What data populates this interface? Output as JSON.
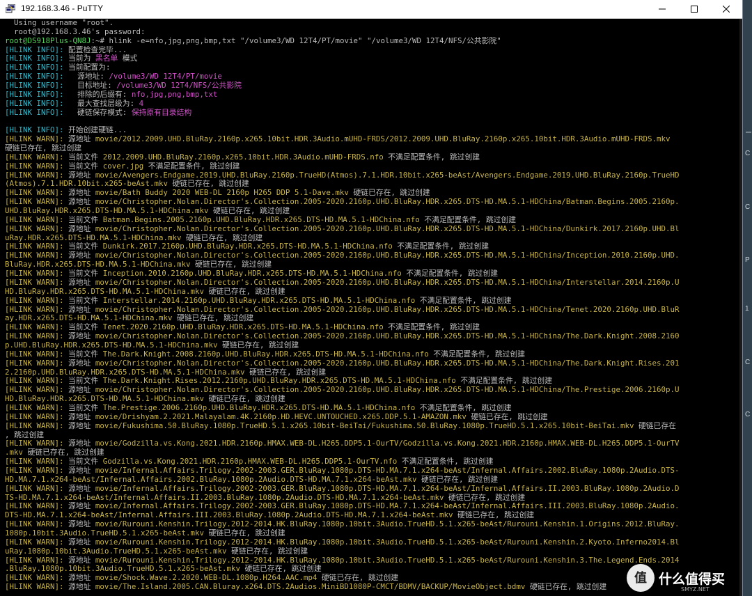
{
  "window": {
    "title": "192.168.3.46 - PuTTY"
  },
  "watermark": {
    "text": "什么值得买",
    "sub": "SMYZ.NET"
  },
  "side_glyphs": [
    "ー",
    "C",
    "C",
    "P",
    "1",
    "C",
    "C"
  ],
  "colors": {
    "info": "#3ab7c8",
    "warn": "#c8b44a",
    "highlight": "#d052c8",
    "prompt": "#55d45c",
    "text": "#bbbbbb"
  },
  "terminal": {
    "lines": [
      [
        {
          "t": "  Using username \"root\".",
          "c": "white"
        }
      ],
      [
        {
          "t": "  root@192.168.3.46's password:",
          "c": "white"
        }
      ],
      [
        {
          "t": "root@DS918Plus-QN8J",
          "c": "green"
        },
        {
          "t": ":~# hlink -e=nfo,jpg,png,bmp,txt \"/volume3/WD 12T4/PT/movie\" \"/volume3/WD 12T4/NFS/公共影院\"",
          "c": "white"
        }
      ],
      [
        {
          "t": "[HLINK INFO]: ",
          "c": "cyan"
        },
        {
          "t": "配置检查完毕...",
          "c": "white"
        }
      ],
      [
        {
          "t": "[HLINK INFO]: ",
          "c": "cyan"
        },
        {
          "t": "当前为 ",
          "c": "white"
        },
        {
          "t": "黑名单",
          "c": "magenta"
        },
        {
          "t": " 模式",
          "c": "white"
        }
      ],
      [
        {
          "t": "[HLINK INFO]: ",
          "c": "cyan"
        },
        {
          "t": "当前配置为:",
          "c": "white"
        }
      ],
      [
        {
          "t": "[HLINK INFO]: ",
          "c": "cyan"
        },
        {
          "t": "  源地址: ",
          "c": "white"
        },
        {
          "t": "/volume3/WD 12T4/PT/movie",
          "c": "magenta"
        }
      ],
      [
        {
          "t": "[HLINK INFO]: ",
          "c": "cyan"
        },
        {
          "t": "  目标地址: ",
          "c": "white"
        },
        {
          "t": "/volume3/WD 12T4/NFS/公共影院",
          "c": "magenta"
        }
      ],
      [
        {
          "t": "[HLINK INFO]: ",
          "c": "cyan"
        },
        {
          "t": "  排除的后缀有: ",
          "c": "white"
        },
        {
          "t": "nfo,jpg,png,bmp,txt",
          "c": "magenta"
        }
      ],
      [
        {
          "t": "[HLINK INFO]: ",
          "c": "cyan"
        },
        {
          "t": "  最大查找层级为: ",
          "c": "white"
        },
        {
          "t": "4",
          "c": "magenta"
        }
      ],
      [
        {
          "t": "[HLINK INFO]: ",
          "c": "cyan"
        },
        {
          "t": "  硬链保存模式: ",
          "c": "white"
        },
        {
          "t": "保持原有目录结构",
          "c": "magenta"
        }
      ],
      [
        {
          "t": "",
          "c": "white"
        }
      ],
      [
        {
          "t": "[HLINK INFO]: ",
          "c": "cyan"
        },
        {
          "t": "开始创建硬链...",
          "c": "white"
        }
      ],
      [
        {
          "t": "[HLINK WARN]: ",
          "c": "yellow"
        },
        {
          "t": "源地址 ",
          "c": "white"
        },
        {
          "t": "movie/2012.2009.UHD.BluRay.2160p.x265.10bit.HDR.3Audio.mUHD-FRDS/2012.2009.UHD.BluRay.2160p.x265.10bit.HDR.3Audio.mUHD-FRDS.mkv",
          "c": "yellow"
        }
      ],
      [
        {
          "t": "硬链已存在, 跳过创建",
          "c": "white"
        }
      ],
      [
        {
          "t": "[HLINK WARN]: ",
          "c": "yellow"
        },
        {
          "t": "当前文件 ",
          "c": "white"
        },
        {
          "t": "2012.2009.UHD.BluRay.2160p.x265.10bit.HDR.3Audio.mUHD-FRDS.nfo",
          "c": "yellow"
        },
        {
          "t": " 不满足配置条件, 跳过创建",
          "c": "white"
        }
      ],
      [
        {
          "t": "[HLINK WARN]: ",
          "c": "yellow"
        },
        {
          "t": "当前文件 ",
          "c": "white"
        },
        {
          "t": "cover.jpg",
          "c": "yellow"
        },
        {
          "t": " 不满足配置条件, 跳过创建",
          "c": "white"
        }
      ],
      [
        {
          "t": "[HLINK WARN]: ",
          "c": "yellow"
        },
        {
          "t": "源地址 ",
          "c": "white"
        },
        {
          "t": "movie/Avengers.Endgame.2019.UHD.BluRay.2160p.TrueHD(Atmos).7.1.HDR.10bit.x265-beAst/Avengers.Endgame.2019.UHD.BluRay.2160p.TrueHD",
          "c": "yellow"
        }
      ],
      [
        {
          "t": "(Atmos).7.1.HDR.10bit.x265-beAst.mkv",
          "c": "yellow"
        },
        {
          "t": " 硬链已存在, 跳过创建",
          "c": "white"
        }
      ],
      [
        {
          "t": "[HLINK WARN]: ",
          "c": "yellow"
        },
        {
          "t": "源地址 ",
          "c": "white"
        },
        {
          "t": "movie/Bath Buddy 2020 WEB-DL 2160p H265 DDP 5.1-Dave.mkv",
          "c": "yellow"
        },
        {
          "t": " 硬链已存在, 跳过创建",
          "c": "white"
        }
      ],
      [
        {
          "t": "[HLINK WARN]: ",
          "c": "yellow"
        },
        {
          "t": "源地址 ",
          "c": "white"
        },
        {
          "t": "movie/Christopher.Nolan.Director's.Collection.2005-2020.2160p.UHD.BluRay.HDR.x265.DTS-HD.MA.5.1-HDChina/Batman.Begins.2005.2160p.",
          "c": "yellow"
        }
      ],
      [
        {
          "t": "UHD.BluRay.HDR.x265.DTS-HD.MA.5.1-HDChina.mkv",
          "c": "yellow"
        },
        {
          "t": " 硬链已存在, 跳过创建",
          "c": "white"
        }
      ],
      [
        {
          "t": "[HLINK WARN]: ",
          "c": "yellow"
        },
        {
          "t": "当前文件 ",
          "c": "white"
        },
        {
          "t": "Batman.Begins.2005.2160p.UHD.BluRay.HDR.x265.DTS-HD.MA.5.1-HDChina.nfo",
          "c": "yellow"
        },
        {
          "t": " 不满足配置条件, 跳过创建",
          "c": "white"
        }
      ],
      [
        {
          "t": "[HLINK WARN]: ",
          "c": "yellow"
        },
        {
          "t": "源地址 ",
          "c": "white"
        },
        {
          "t": "movie/Christopher.Nolan.Director's.Collection.2005-2020.2160p.UHD.BluRay.HDR.x265.DTS-HD.MA.5.1-HDChina/Dunkirk.2017.2160p.UHD.Bl",
          "c": "yellow"
        }
      ],
      [
        {
          "t": "uRay.HDR.x265.DTS-HD.MA.5.1-HDChina.mkv",
          "c": "yellow"
        },
        {
          "t": " 硬链已存在, 跳过创建",
          "c": "white"
        }
      ],
      [
        {
          "t": "[HLINK WARN]: ",
          "c": "yellow"
        },
        {
          "t": "当前文件 ",
          "c": "white"
        },
        {
          "t": "Dunkirk.2017.2160p.UHD.BluRay.HDR.x265.DTS-HD.MA.5.1-HDChina.nfo",
          "c": "yellow"
        },
        {
          "t": " 不满足配置条件, 跳过创建",
          "c": "white"
        }
      ],
      [
        {
          "t": "[HLINK WARN]: ",
          "c": "yellow"
        },
        {
          "t": "源地址 ",
          "c": "white"
        },
        {
          "t": "movie/Christopher.Nolan.Director's.Collection.2005-2020.2160p.UHD.BluRay.HDR.x265.DTS-HD.MA.5.1-HDChina/Inception.2010.2160p.UHD.",
          "c": "yellow"
        }
      ],
      [
        {
          "t": "BluRay.HDR.x265.DTS-HD.MA.5.1-HDChina.mkv",
          "c": "yellow"
        },
        {
          "t": " 硬链已存在, 跳过创建",
          "c": "white"
        }
      ],
      [
        {
          "t": "[HLINK WARN]: ",
          "c": "yellow"
        },
        {
          "t": "当前文件 ",
          "c": "white"
        },
        {
          "t": "Inception.2010.2160p.UHD.BluRay.HDR.x265.DTS-HD.MA.5.1-HDChina.nfo",
          "c": "yellow"
        },
        {
          "t": " 不满足配置条件, 跳过创建",
          "c": "white"
        }
      ],
      [
        {
          "t": "[HLINK WARN]: ",
          "c": "yellow"
        },
        {
          "t": "源地址 ",
          "c": "white"
        },
        {
          "t": "movie/Christopher.Nolan.Director's.Collection.2005-2020.2160p.UHD.BluRay.HDR.x265.DTS-HD.MA.5.1-HDChina/Interstellar.2014.2160p.U",
          "c": "yellow"
        }
      ],
      [
        {
          "t": "HD.BluRay.HDR.x265.DTS-HD.MA.5.1-HDChina.mkv",
          "c": "yellow"
        },
        {
          "t": " 硬链已存在, 跳过创建",
          "c": "white"
        }
      ],
      [
        {
          "t": "[HLINK WARN]: ",
          "c": "yellow"
        },
        {
          "t": "当前文件 ",
          "c": "white"
        },
        {
          "t": "Interstellar.2014.2160p.UHD.BluRay.HDR.x265.DTS-HD.MA.5.1-HDChina.nfo",
          "c": "yellow"
        },
        {
          "t": " 不满足配置条件, 跳过创建",
          "c": "white"
        }
      ],
      [
        {
          "t": "[HLINK WARN]: ",
          "c": "yellow"
        },
        {
          "t": "源地址 ",
          "c": "white"
        },
        {
          "t": "movie/Christopher.Nolan.Director's.Collection.2005-2020.2160p.UHD.BluRay.HDR.x265.DTS-HD.MA.5.1-HDChina/Tenet.2020.2160p.UHD.BluR",
          "c": "yellow"
        }
      ],
      [
        {
          "t": "ay.HDR.x265.DTS-HD.MA.5.1-HDChina.mkv",
          "c": "yellow"
        },
        {
          "t": " 硬链已存在, 跳过创建",
          "c": "white"
        }
      ],
      [
        {
          "t": "[HLINK WARN]: ",
          "c": "yellow"
        },
        {
          "t": "当前文件 ",
          "c": "white"
        },
        {
          "t": "Tenet.2020.2160p.UHD.BluRay.HDR.x265.DTS-HD.MA.5.1-HDChina.nfo",
          "c": "yellow"
        },
        {
          "t": " 不满足配置条件, 跳过创建",
          "c": "white"
        }
      ],
      [
        {
          "t": "[HLINK WARN]: ",
          "c": "yellow"
        },
        {
          "t": "源地址 ",
          "c": "white"
        },
        {
          "t": "movie/Christopher.Nolan.Director's.Collection.2005-2020.2160p.UHD.BluRay.HDR.x265.DTS-HD.MA.5.1-HDChina/The.Dark.Knight.2008.2160",
          "c": "yellow"
        }
      ],
      [
        {
          "t": "p.UHD.BluRay.HDR.x265.DTS-HD.MA.5.1-HDChina.mkv",
          "c": "yellow"
        },
        {
          "t": " 硬链已存在, 跳过创建",
          "c": "white"
        }
      ],
      [
        {
          "t": "[HLINK WARN]: ",
          "c": "yellow"
        },
        {
          "t": "当前文件 ",
          "c": "white"
        },
        {
          "t": "The.Dark.Knight.2008.2160p.UHD.BluRay.HDR.x265.DTS-HD.MA.5.1-HDChina.nfo",
          "c": "yellow"
        },
        {
          "t": " 不满足配置条件, 跳过创建",
          "c": "white"
        }
      ],
      [
        {
          "t": "[HLINK WARN]: ",
          "c": "yellow"
        },
        {
          "t": "源地址 ",
          "c": "white"
        },
        {
          "t": "movie/Christopher.Nolan.Director's.Collection.2005-2020.2160p.UHD.BluRay.HDR.x265.DTS-HD.MA.5.1-HDChina/The.Dark.Knight.Rises.201",
          "c": "yellow"
        }
      ],
      [
        {
          "t": "2.2160p.UHD.BluRay.HDR.x265.DTS-HD.MA.5.1-HDChina.mkv",
          "c": "yellow"
        },
        {
          "t": " 硬链已存在, 跳过创建",
          "c": "white"
        }
      ],
      [
        {
          "t": "[HLINK WARN]: ",
          "c": "yellow"
        },
        {
          "t": "当前文件 ",
          "c": "white"
        },
        {
          "t": "The.Dark.Knight.Rises.2012.2160p.UHD.BluRay.HDR.x265.DTS-HD.MA.5.1-HDChina.nfo",
          "c": "yellow"
        },
        {
          "t": " 不满足配置条件, 跳过创建",
          "c": "white"
        }
      ],
      [
        {
          "t": "[HLINK WARN]: ",
          "c": "yellow"
        },
        {
          "t": "源地址 ",
          "c": "white"
        },
        {
          "t": "movie/Christopher.Nolan.Director's.Collection.2005-2020.2160p.UHD.BluRay.HDR.x265.DTS-HD.MA.5.1-HDChina/The.Prestige.2006.2160p.U",
          "c": "yellow"
        }
      ],
      [
        {
          "t": "HD.BluRay.HDR.x265.DTS-HD.MA.5.1-HDChina.mkv",
          "c": "yellow"
        },
        {
          "t": " 硬链已存在, 跳过创建",
          "c": "white"
        }
      ],
      [
        {
          "t": "[HLINK WARN]: ",
          "c": "yellow"
        },
        {
          "t": "当前文件 ",
          "c": "white"
        },
        {
          "t": "The.Prestige.2006.2160p.UHD.BluRay.HDR.x265.DTS-HD.MA.5.1-HDChina.nfo",
          "c": "yellow"
        },
        {
          "t": " 不满足配置条件, 跳过创建",
          "c": "white"
        }
      ],
      [
        {
          "t": "[HLINK WARN]: ",
          "c": "yellow"
        },
        {
          "t": "源地址 ",
          "c": "white"
        },
        {
          "t": "movie/Drishyam.2.2021.Malayalam.4K.2160p.HD.HEVC.UNTOUCHED.x265.DDP.5.1-AMAZON.mkv",
          "c": "yellow"
        },
        {
          "t": " 硬链已存在, 跳过创建",
          "c": "white"
        }
      ],
      [
        {
          "t": "[HLINK WARN]: ",
          "c": "yellow"
        },
        {
          "t": "源地址 ",
          "c": "white"
        },
        {
          "t": "movie/Fukushima.50.BluRay.1080p.TrueHD.5.1.x265.10bit-BeiTai/Fukushima.50.BluRay.1080p.TrueHD.5.1.x265.10bit-BeiTai.mkv",
          "c": "yellow"
        },
        {
          "t": " 硬链已存在",
          "c": "white"
        }
      ],
      [
        {
          "t": ", 跳过创建",
          "c": "white"
        }
      ],
      [
        {
          "t": "[HLINK WARN]: ",
          "c": "yellow"
        },
        {
          "t": "源地址 ",
          "c": "white"
        },
        {
          "t": "movie/Godzilla.vs.Kong.2021.HDR.2160p.HMAX.WEB-DL.H265.DDP5.1-OurTV/Godzilla.vs.Kong.2021.HDR.2160p.HMAX.WEB-DL.H265.DDP5.1-OurTV",
          "c": "yellow"
        }
      ],
      [
        {
          "t": ".mkv",
          "c": "yellow"
        },
        {
          "t": " 硬链已存在, 跳过创建",
          "c": "white"
        }
      ],
      [
        {
          "t": "[HLINK WARN]: ",
          "c": "yellow"
        },
        {
          "t": "当前文件 ",
          "c": "white"
        },
        {
          "t": "Godzilla.vs.Kong.2021.HDR.2160p.HMAX.WEB-DL.H265.DDP5.1-OurTV.nfo",
          "c": "yellow"
        },
        {
          "t": " 不满足配置条件, 跳过创建",
          "c": "white"
        }
      ],
      [
        {
          "t": "[HLINK WARN]: ",
          "c": "yellow"
        },
        {
          "t": "源地址 ",
          "c": "white"
        },
        {
          "t": "movie/Infernal.Affairs.Trilogy.2002-2003.GER.BluRay.1080p.DTS-HD.MA.7.1.x264-beAst/Infernal.Affairs.2002.BluRay.1080p.2Audio.DTS-",
          "c": "yellow"
        }
      ],
      [
        {
          "t": "HD.MA.7.1.x264-beAst/Infernal.Affairs.2002.BluRay.1080p.2Audio.DTS-HD.MA.7.1.x264-beAst.mkv",
          "c": "yellow"
        },
        {
          "t": " 硬链已存在, 跳过创建",
          "c": "white"
        }
      ],
      [
        {
          "t": "[HLINK WARN]: ",
          "c": "yellow"
        },
        {
          "t": "源地址 ",
          "c": "white"
        },
        {
          "t": "movie/Infernal.Affairs.Trilogy.2002-2003.GER.BluRay.1080p.DTS-HD.MA.7.1.x264-beAst/Infernal.Affairs.II.2003.BluRay.1080p.2Audio.D",
          "c": "yellow"
        }
      ],
      [
        {
          "t": "TS-HD.MA.7.1.x264-beAst/Infernal.Affairs.II.2003.BluRay.1080p.2Audio.DTS-HD.MA.7.1.x264-beAst.mkv",
          "c": "yellow"
        },
        {
          "t": " 硬链已存在, 跳过创建",
          "c": "white"
        }
      ],
      [
        {
          "t": "[HLINK WARN]: ",
          "c": "yellow"
        },
        {
          "t": "源地址 ",
          "c": "white"
        },
        {
          "t": "movie/Infernal.Affairs.Trilogy.2002-2003.GER.BluRay.1080p.DTS-HD.MA.7.1.x264-beAst/Infernal.Affairs.III.2003.BluRay.1080p.2Audio.",
          "c": "yellow"
        }
      ],
      [
        {
          "t": "DTS-HD.MA.7.1.x264-beAst/Infernal.Affairs.III.2003.BluRay.1080p.2Audio.DTS-HD.MA.7.1.x264-beAst.mkv",
          "c": "yellow"
        },
        {
          "t": " 硬链已存在, 跳过创建",
          "c": "white"
        }
      ],
      [
        {
          "t": "[HLINK WARN]: ",
          "c": "yellow"
        },
        {
          "t": "源地址 ",
          "c": "white"
        },
        {
          "t": "movie/Rurouni.Kenshin.Trilogy.2012-2014.HK.BluRay.1080p.10bit.3Audio.TrueHD.5.1.x265-beAst/Rurouni.Kenshin.1.Origins.2012.BluRay.",
          "c": "yellow"
        }
      ],
      [
        {
          "t": "1080p.10bit.3Audio.TrueHD.5.1.x265-beAst.mkv",
          "c": "yellow"
        },
        {
          "t": " 硬链已存在, 跳过创建",
          "c": "white"
        }
      ],
      [
        {
          "t": "[HLINK WARN]: ",
          "c": "yellow"
        },
        {
          "t": "源地址 ",
          "c": "white"
        },
        {
          "t": "movie/Rurouni.Kenshin.Trilogy.2012-2014.HK.BluRay.1080p.10bit.3Audio.TrueHD.5.1.x265-beAst/Rurouni.Kenshin.2.Kyoto.Inferno2014.Bl",
          "c": "yellow"
        }
      ],
      [
        {
          "t": "uRay.1080p.10bit.3Audio.TrueHD.5.1.x265-beAst.mkv",
          "c": "yellow"
        },
        {
          "t": " 硬链已存在, 跳过创建",
          "c": "white"
        }
      ],
      [
        {
          "t": "[HLINK WARN]: ",
          "c": "yellow"
        },
        {
          "t": "源地址 ",
          "c": "white"
        },
        {
          "t": "movie/Rurouni.Kenshin.Trilogy.2012-2014.HK.BluRay.1080p.10bit.3Audio.TrueHD.5.1.x265-beAst/Rurouni.Kenshin.3.The.Legend.Ends.2014",
          "c": "yellow"
        }
      ],
      [
        {
          "t": ".BluRay.1080p.10bit.3Audio.TrueHD.5.1.x265-beAst.mkv",
          "c": "yellow"
        },
        {
          "t": " 硬链已存在, 跳过创建",
          "c": "white"
        }
      ],
      [
        {
          "t": "[HLINK WARN]: ",
          "c": "yellow"
        },
        {
          "t": "源地址 ",
          "c": "white"
        },
        {
          "t": "movie/Shock.Wave.2.2020.WEB-DL.1080p.H264.AAC.mp4",
          "c": "yellow"
        },
        {
          "t": " 硬链已存在, 跳过创建",
          "c": "white"
        }
      ],
      [
        {
          "t": "[HLINK WARN]: ",
          "c": "yellow"
        },
        {
          "t": "源地址 ",
          "c": "white"
        },
        {
          "t": "movie/The.Island.2005.CAN.Bluray.x264.DTS.2Audios.MiniBD1080P-CMCT/BDMV/BACKUP/MovieObject.bdmv",
          "c": "yellow"
        },
        {
          "t": " 硬链已存在, 跳过创建",
          "c": "white"
        }
      ]
    ]
  }
}
